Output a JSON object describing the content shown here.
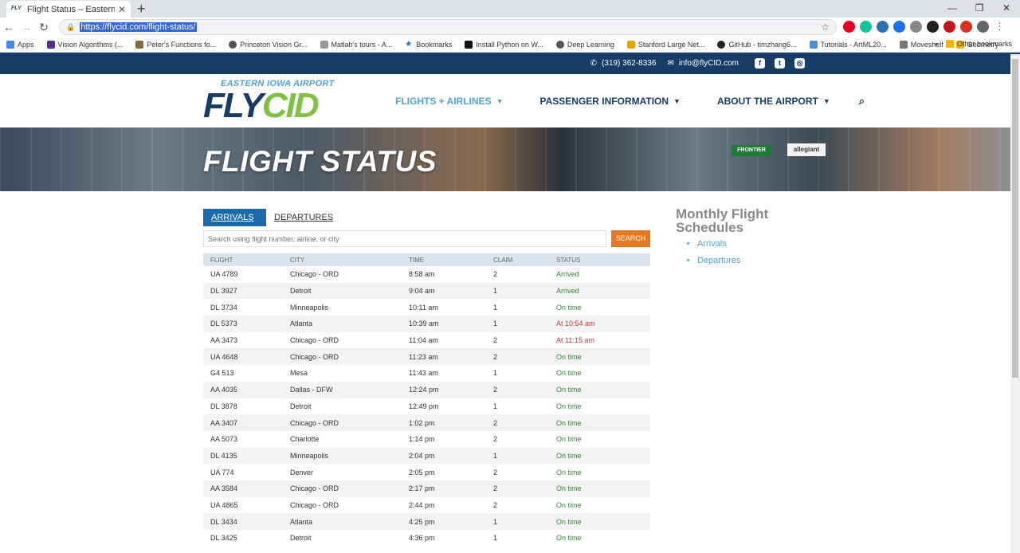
{
  "browser": {
    "tab_title": "Flight Status – Eastern Iowa Airp",
    "tab_favicon": "FLY",
    "url": "https://flycid.com/flight-status/",
    "bookmarks": [
      "Apps",
      "Vision Algorithms (...",
      "Peter's Functions fo...",
      "Princeton Vision Gr...",
      "Matlab's tours - A...",
      "Bookmarks",
      "Install Python on W...",
      "Deep Learning",
      "Stanford Large Net...",
      "GitHub - timzhang6...",
      "Tutorials - ArtML20...",
      "Moveshelf",
      "Geometry"
    ],
    "other_bookmarks": "Other bookmarks"
  },
  "topbar": {
    "phone": "(319) 362-8336",
    "email": "info@flyCID.com",
    "social": [
      "facebook-icon",
      "twitter-icon",
      "instagram-icon"
    ]
  },
  "logo": {
    "tagline": "EASTERN IOWA AIRPORT",
    "fly": "FLY",
    "cid": "CID"
  },
  "nav": {
    "flights": "FLIGHTS + AIRLINES",
    "passenger": "PASSENGER INFORMATION",
    "about": "ABOUT THE AIRPORT"
  },
  "hero": {
    "title": "FLIGHT STATUS",
    "sign_frontier": "FRONTIER",
    "sign_allegiant": "allegiant"
  },
  "tabs": {
    "arrivals": "ARRIVALS",
    "departures": "DEPARTURES"
  },
  "search": {
    "placeholder": "Search using flight number, airline, or city",
    "button": "SEARCH"
  },
  "table": {
    "headers": [
      "FLIGHT",
      "CITY",
      "TIME",
      "CLAIM",
      "STATUS"
    ],
    "rows": [
      {
        "flight": "UA 4789",
        "city": "Chicago - ORD",
        "time": "8:58 am",
        "claim": "2",
        "status": "Arrived",
        "color": "green"
      },
      {
        "flight": "DL 3927",
        "city": "Detroit",
        "time": "9:04 am",
        "claim": "1",
        "status": "Arrived",
        "color": "green"
      },
      {
        "flight": "DL 3734",
        "city": "Minneapolis",
        "time": "10:11 am",
        "claim": "1",
        "status": "On time",
        "color": "green"
      },
      {
        "flight": "DL 5373",
        "city": "Atlanta",
        "time": "10:39 am",
        "claim": "1",
        "status": "At 10:54 am",
        "color": "red"
      },
      {
        "flight": "AA 3473",
        "city": "Chicago - ORD",
        "time": "11:04 am",
        "claim": "2",
        "status": "At 11:15 am",
        "color": "red"
      },
      {
        "flight": "UA 4648",
        "city": "Chicago - ORD",
        "time": "11:23 am",
        "claim": "2",
        "status": "On time",
        "color": "green"
      },
      {
        "flight": "G4 513",
        "city": "Mesa",
        "time": "11:43 am",
        "claim": "1",
        "status": "On time",
        "color": "green"
      },
      {
        "flight": "AA 4035",
        "city": "Dallas - DFW",
        "time": "12:24 pm",
        "claim": "2",
        "status": "On time",
        "color": "green"
      },
      {
        "flight": "DL 3878",
        "city": "Detroit",
        "time": "12:49 pm",
        "claim": "1",
        "status": "On time",
        "color": "green"
      },
      {
        "flight": "AA 3407",
        "city": "Chicago - ORD",
        "time": "1:02 pm",
        "claim": "2",
        "status": "On time",
        "color": "green"
      },
      {
        "flight": "AA 5073",
        "city": "Charlotte",
        "time": "1:14 pm",
        "claim": "2",
        "status": "On time",
        "color": "green"
      },
      {
        "flight": "DL 4135",
        "city": "Minneapolis",
        "time": "2:04 pm",
        "claim": "1",
        "status": "On time",
        "color": "green"
      },
      {
        "flight": "UA 774",
        "city": "Denver",
        "time": "2:05 pm",
        "claim": "2",
        "status": "On time",
        "color": "green"
      },
      {
        "flight": "AA 3584",
        "city": "Chicago - ORD",
        "time": "2:17 pm",
        "claim": "2",
        "status": "On time",
        "color": "green"
      },
      {
        "flight": "UA 4865",
        "city": "Chicago - ORD",
        "time": "2:44 pm",
        "claim": "2",
        "status": "On time",
        "color": "green"
      },
      {
        "flight": "DL 3434",
        "city": "Atlanta",
        "time": "4:25 pm",
        "claim": "1",
        "status": "On time",
        "color": "green"
      },
      {
        "flight": "DL 3425",
        "city": "Detroit",
        "time": "4:36 pm",
        "claim": "1",
        "status": "On time",
        "color": "green"
      }
    ]
  },
  "sidebar": {
    "title": "Monthly Flight Schedules",
    "links": [
      "Arrivals",
      "Departures"
    ]
  },
  "colors": {
    "brand_navy": "#173d66",
    "brand_blue": "#4fa3d9",
    "brand_green": "#7dc242",
    "search_orange": "#e87722",
    "status_green": "#2e8b2e",
    "status_red": "#c0392b"
  }
}
